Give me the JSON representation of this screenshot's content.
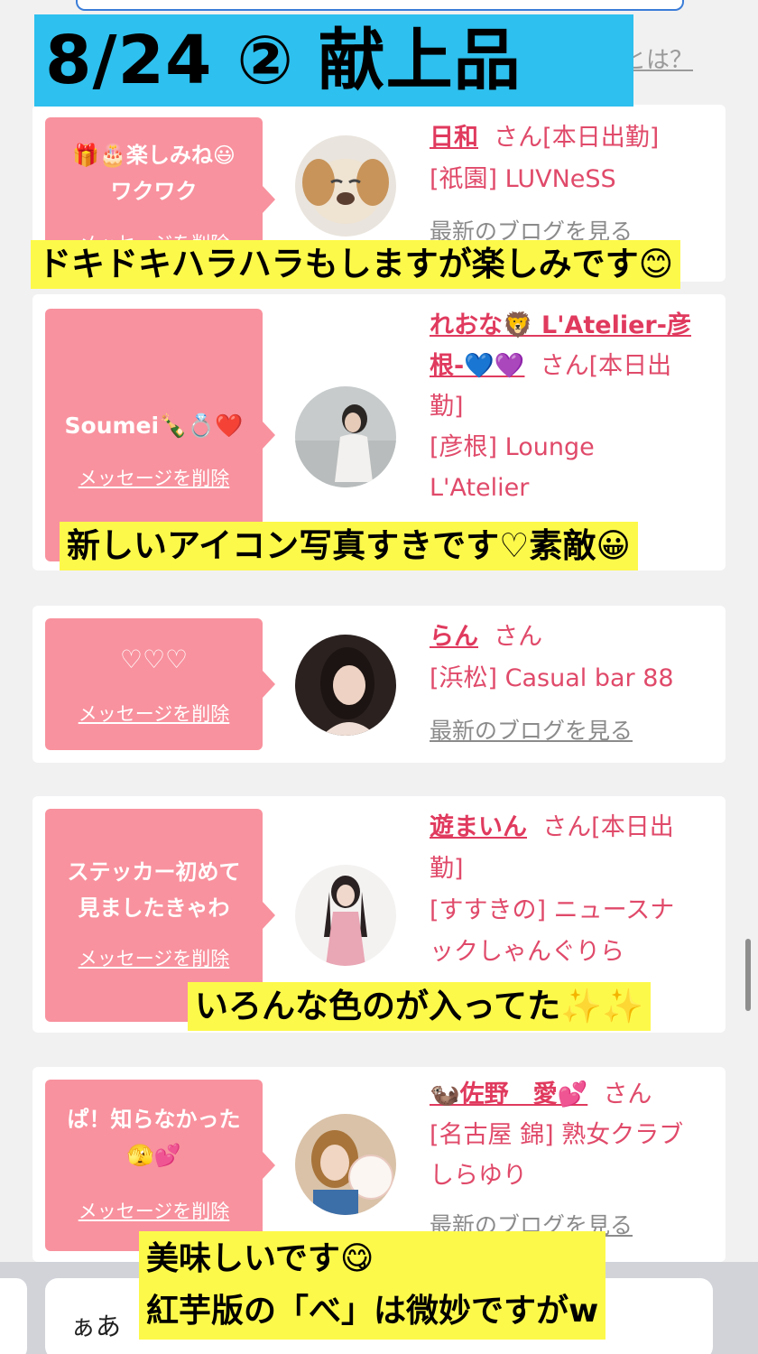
{
  "title": "8/24 ② 献上品",
  "top_link": "とは？",
  "cards": [
    {
      "message_lines": [
        "🎁🎂楽しみね😃",
        "ワクワク"
      ],
      "delete_label": "メッセージを削除",
      "name": "日和",
      "honorific": "さん[本日出勤]",
      "store": "[祇園] LUVNeSS",
      "blog_link": "最新のブログを見る",
      "caption": "ドキドキハラハラもしますが楽しみです😊"
    },
    {
      "message_lines": [
        "Soumei🍾💍❤️"
      ],
      "delete_label": "メッセージを削除",
      "name_line1": "れおな🦁 L'Atelier-彦",
      "name_line2": "根-💙💜",
      "honorific": "さん[本日出",
      "honorific2": "勤]",
      "store_line1": "[彦根] Lounge",
      "store_line2": "L'Atelier",
      "caption": "新しいアイコン写真すきです♡素敵😀"
    },
    {
      "message_lines": [
        "♡♡♡"
      ],
      "delete_label": "メッセージを削除",
      "name": "らん",
      "honorific": "さん",
      "store": "[浜松] Casual bar 88",
      "blog_link": "最新のブログを見る"
    },
    {
      "message_lines": [
        "ステッカー初めて",
        "見ましたきゃわ"
      ],
      "delete_label": "メッセージを削除",
      "name": "遊まいん",
      "honorific": "さん[本日出",
      "honorific2": "勤]",
      "store_line1": "[すすきの] ニュースナ",
      "store_line2": "ックしゃんぐりら",
      "caption": "いろんな色のが入ってた✨✨"
    },
    {
      "message_lines": [
        "ぱ！知らなかった",
        "🫣💕"
      ],
      "delete_label": "メッセージを削除",
      "name": "🦦佐野　愛💕",
      "honorific": "さん",
      "store_line1": "[名古屋 錦] 熟女クラブ",
      "store_line2": "しらゆり",
      "blog_link": "最新のブログを見る",
      "caption_lines": [
        "美味しいです😋",
        "紅芋版の「べ」は微妙ですがw"
      ]
    }
  ],
  "keyboard": {
    "input_text": "ぁあ"
  },
  "colors": {
    "banner": "#2ec0ee",
    "bubble": "#f8929e",
    "name": "#e03a5e",
    "caption_bg": "#fdf94a"
  }
}
